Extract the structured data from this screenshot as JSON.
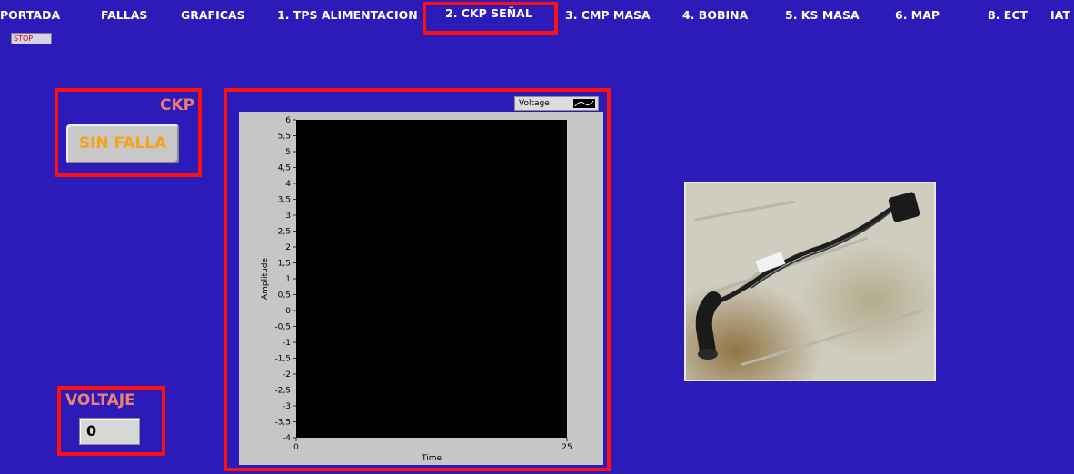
{
  "tabs": [
    {
      "label": "PORTADA"
    },
    {
      "label": "FALLAS"
    },
    {
      "label": "GRAFICAS"
    },
    {
      "label": "1. TPS ALIMENTACION"
    },
    {
      "label": "2. CKP SEÑAL",
      "active": true
    },
    {
      "label": "3. CMP MASA"
    },
    {
      "label": "4. BOBINA"
    },
    {
      "label": "5. KS MASA"
    },
    {
      "label": "6. MAP"
    },
    {
      "label": "8. ECT"
    },
    {
      "label": "IAT"
    }
  ],
  "stop_button": {
    "label": "STOP"
  },
  "sensor_panel": {
    "title": "CKP",
    "status": "SIN FALLA"
  },
  "voltage_panel": {
    "label": "VOLTAJE",
    "value": "0"
  },
  "graph": {
    "legend": "Voltage",
    "ylabel": "Amplitude",
    "xlabel": "Time"
  },
  "chart_data": {
    "type": "line",
    "xlabel": "Time",
    "ylabel": "Amplitude",
    "xlim": [
      0,
      25
    ],
    "ylim": [
      -4,
      6
    ],
    "x_ticks": [
      "0",
      "25"
    ],
    "y_ticks": [
      "6",
      "5,5",
      "5",
      "4,5",
      "4",
      "3,5",
      "3",
      "2,5",
      "2",
      "1,5",
      "1",
      "0,5",
      "0",
      "-0,5",
      "-1",
      "-1,5",
      "-2",
      "-2,5",
      "-3",
      "-3,5",
      "-4"
    ],
    "series": [
      {
        "name": "Voltage",
        "values": []
      }
    ],
    "legend": "top-right"
  },
  "colors": {
    "background": "#2d1bb9",
    "highlight": "#ff1010",
    "title_text": "#f27a70",
    "status_text": "#f6a31c",
    "plot_area": "#000000"
  },
  "photo": {
    "icon": "ckp-sensor-photo"
  }
}
